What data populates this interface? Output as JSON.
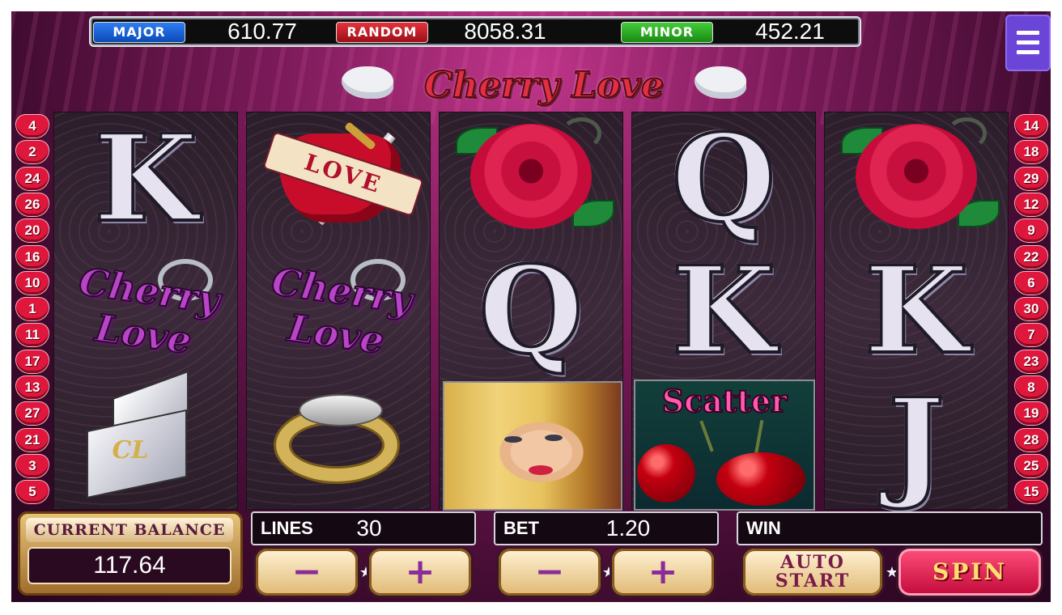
{
  "jackpots": {
    "major": {
      "label": "MAJOR",
      "amount": "610.77"
    },
    "random": {
      "label": "RANDOM",
      "amount": "8058.31"
    },
    "minor": {
      "label": "MINOR",
      "amount": "452.21"
    }
  },
  "logo": {
    "title": "Cherry Love"
  },
  "paylines": {
    "left": [
      "4",
      "2",
      "24",
      "26",
      "20",
      "16",
      "10",
      "1",
      "11",
      "17",
      "13",
      "27",
      "21",
      "3",
      "5"
    ],
    "right": [
      "14",
      "18",
      "29",
      "12",
      "9",
      "22",
      "6",
      "30",
      "7",
      "23",
      "8",
      "19",
      "28",
      "25",
      "15"
    ]
  },
  "reels": [
    [
      "letter-K",
      "keychain",
      "lighter"
    ],
    [
      "love-heart",
      "keychain",
      "gold-ring"
    ],
    [
      "rose",
      "letter-Q",
      "woman"
    ],
    [
      "letter-Q",
      "letter-K",
      "scatter-cherries"
    ],
    [
      "rose",
      "letter-K",
      "letter-J"
    ]
  ],
  "symbol_text": {
    "K": "K",
    "Q": "Q",
    "J": "J",
    "love": "LOVE",
    "keychain": "Cherry Love",
    "lighter": "CL",
    "scatter": "Scatter"
  },
  "controls": {
    "balance_label": "CURRENT BALANCE",
    "balance_value": "117.64",
    "lines_label": "LINES",
    "lines_value": "30",
    "bet_label": "BET",
    "bet_value": "1.20",
    "win_label": "WIN",
    "win_value": "",
    "minus": "−",
    "plus": "+",
    "auto_start_line1": "AUTO",
    "auto_start_line2": "START",
    "spin_label": "SPIN"
  }
}
